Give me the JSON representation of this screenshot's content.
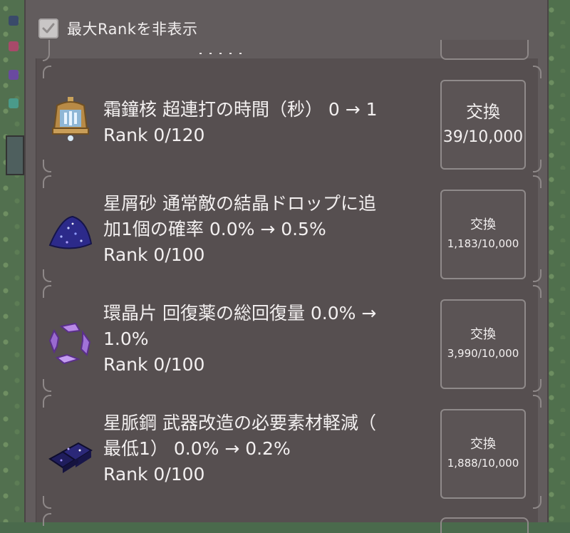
{
  "header": {
    "hide_max_rank_label": "最大Rankを非表示",
    "hide_max_rank_checked": true
  },
  "items": [
    {
      "icon": "frost-bell-core-icon",
      "line1": "霜鐘核  超連打の時間（秒） 0 → 1",
      "line2": "",
      "rank": "Rank 0/120",
      "button_label": "交換",
      "button_count": "39/10,000"
    },
    {
      "icon": "star-dust-icon",
      "line1": "星屑砂  通常敵の結晶ドロップに追",
      "line2": "加1個の確率 0.0% → 0.5%",
      "rank": "Rank 0/100",
      "button_label": "交換",
      "button_count": "1,183/10,000"
    },
    {
      "icon": "ring-crystal-shard-icon",
      "line1": "環晶片  回復薬の総回復量 0.0% →",
      "line2": "1.0%",
      "rank": "Rank 0/100",
      "button_label": "交換",
      "button_count": "3,990/10,000"
    },
    {
      "icon": "star-vein-steel-icon",
      "line1": "星脈鋼  武器改造の必要素材軽減（",
      "line2": "最低1） 0.0% → 0.2%",
      "rank": "Rank 0/100",
      "button_label": "交換",
      "button_count": "1,888/10,000"
    }
  ],
  "colors": {
    "panel": "#625c5d",
    "inner": "#564f50",
    "text": "#f3f0f0",
    "border": "#8e8888"
  }
}
